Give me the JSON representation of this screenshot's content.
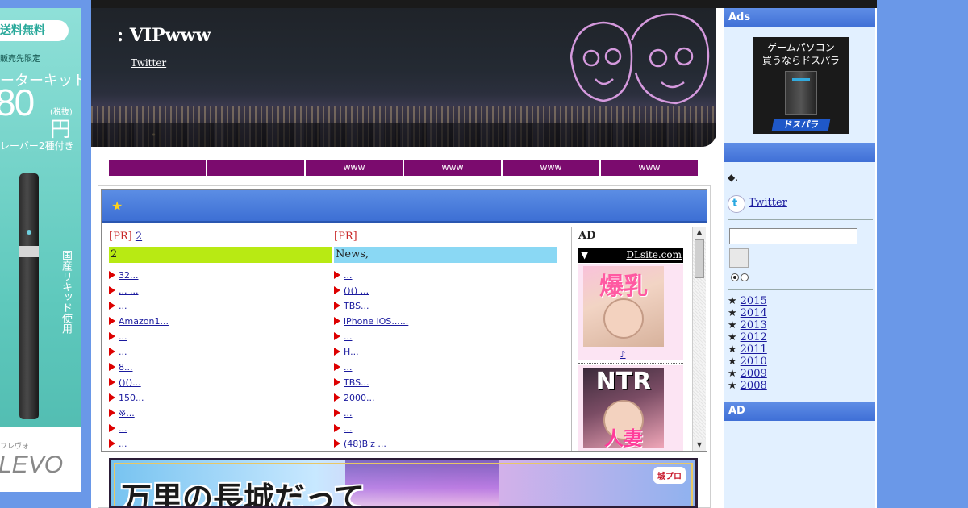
{
  "left_ad": {
    "pill": "送料無料",
    "subtitle": "販売先限定",
    "kit": "ーターキット",
    "price": "80",
    "tax": "(税抜)",
    "yen": "円",
    "cover": "レーバー2種付き",
    "vertical": "国産リキッド使用",
    "logo_small": "フレヴォ",
    "logo": "LEVO",
    "pen_text": "FLEVO"
  },
  "header": {
    "title": ": VIPwww",
    "link": "Twitter"
  },
  "nav": [
    {
      "label": ""
    },
    {
      "label": ""
    },
    {
      "label": "www"
    },
    {
      "label": "www"
    },
    {
      "label": "www"
    },
    {
      "label": "www"
    }
  ],
  "pr_panel": {
    "star": "★",
    "left": {
      "pr_prefix": "[PR]",
      "pr_link": "2",
      "header": "2",
      "header_color": "#b8ea13",
      "items": [
        "32...",
        "...  ...",
        "...",
        "Amazon1...",
        "...",
        "...",
        "8...",
        "()()...",
        "150...",
        "※...",
        "...",
        "..."
      ]
    },
    "right": {
      "pr_prefix": "[PR]",
      "pr_link": "",
      "header": "News,",
      "header_color": "#8ad8f4",
      "items": [
        "...",
        "()() ...",
        "TBS...",
        "iPhone iOS......",
        "...",
        "H...",
        "...",
        "TBS...",
        "2000...",
        "...",
        "...",
        "(48)B'z ..."
      ]
    },
    "ad": {
      "label": "AD",
      "bar_arrow": "▼",
      "bar_site": "DLsite.com",
      "card1_text": "爆乳",
      "card1_note": "♪",
      "card2_text": "NTR",
      "card2_sub": "人妻"
    }
  },
  "banner": {
    "text": "万里の長城だって",
    "logo": "城プロ"
  },
  "sidebar": {
    "ads_title": "Ads",
    "dospara_line1": "ゲームパソコン",
    "dospara_line2": "買うならドスパラ",
    "dospara_brand": "ドスパラ",
    "section2_title": "",
    "diamond_text": "◆.",
    "twitter_label": "Twitter",
    "search_placeholder": "",
    "years": [
      "2015",
      "2014",
      "2013",
      "2012",
      "2011",
      "2010",
      "2009",
      "2008"
    ],
    "ad_title": "AD"
  },
  "colors": {
    "nav_bg": "#7b0b6e",
    "sidebar_head": "#4a7bde",
    "page_bg": "#6a98e8"
  }
}
